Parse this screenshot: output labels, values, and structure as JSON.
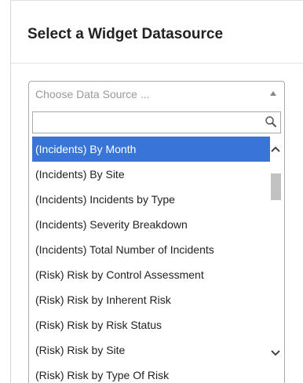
{
  "modal": {
    "title": "Select a Widget Datasource"
  },
  "select": {
    "placeholder": "Choose Data Source ...",
    "search_value": ""
  },
  "options": [
    "(Incidents) By Month",
    "(Incidents) By Site",
    "(Incidents) Incidents by Type",
    "(Incidents) Severity Breakdown",
    "(Incidents) Total Number of Incidents",
    "(Risk) Risk by Control Assessment",
    "(Risk) Risk by Inherent Risk",
    "(Risk) Risk by Risk Status",
    "(Risk) Risk by Site",
    "(Risk) Risk by Type Of Risk"
  ],
  "highlighted_index": 0,
  "colors": {
    "highlight": "#3875d7",
    "border": "#aaaaaa",
    "title": "#222222",
    "placeholder": "#999999"
  },
  "icons": {
    "search": "search-icon",
    "arrow": "chevron-up-icon",
    "scroll_up": "chevron-up-icon",
    "scroll_down": "chevron-down-icon"
  }
}
